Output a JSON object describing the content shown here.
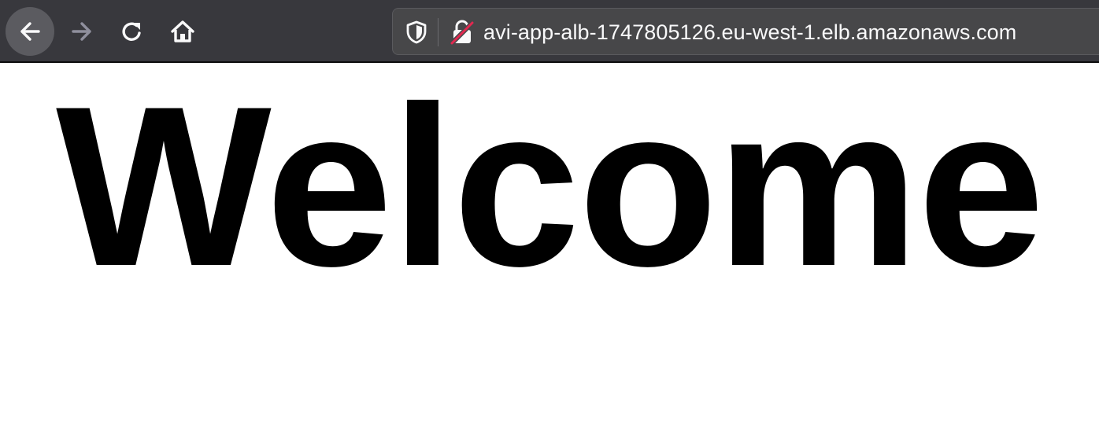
{
  "browser": {
    "colors": {
      "toolbar_bg": "#38383d",
      "urlbar_bg": "#474749",
      "icon_active": "#f9f9fa",
      "icon_disabled": "#8f8f9d",
      "insecure_slash": "#e22850"
    },
    "nav": {
      "back_icon": "arrow-left-icon",
      "forward_icon": "arrow-right-icon",
      "reload_icon": "reload-icon",
      "home_icon": "home-icon"
    },
    "urlbar": {
      "tracking_icon": "shield-icon",
      "security_icon": "insecure-lock-icon",
      "url": "avi-app-alb-1747805126.eu-west-1.elb.amazonaws.com"
    }
  },
  "page": {
    "heading": "Welcome"
  }
}
